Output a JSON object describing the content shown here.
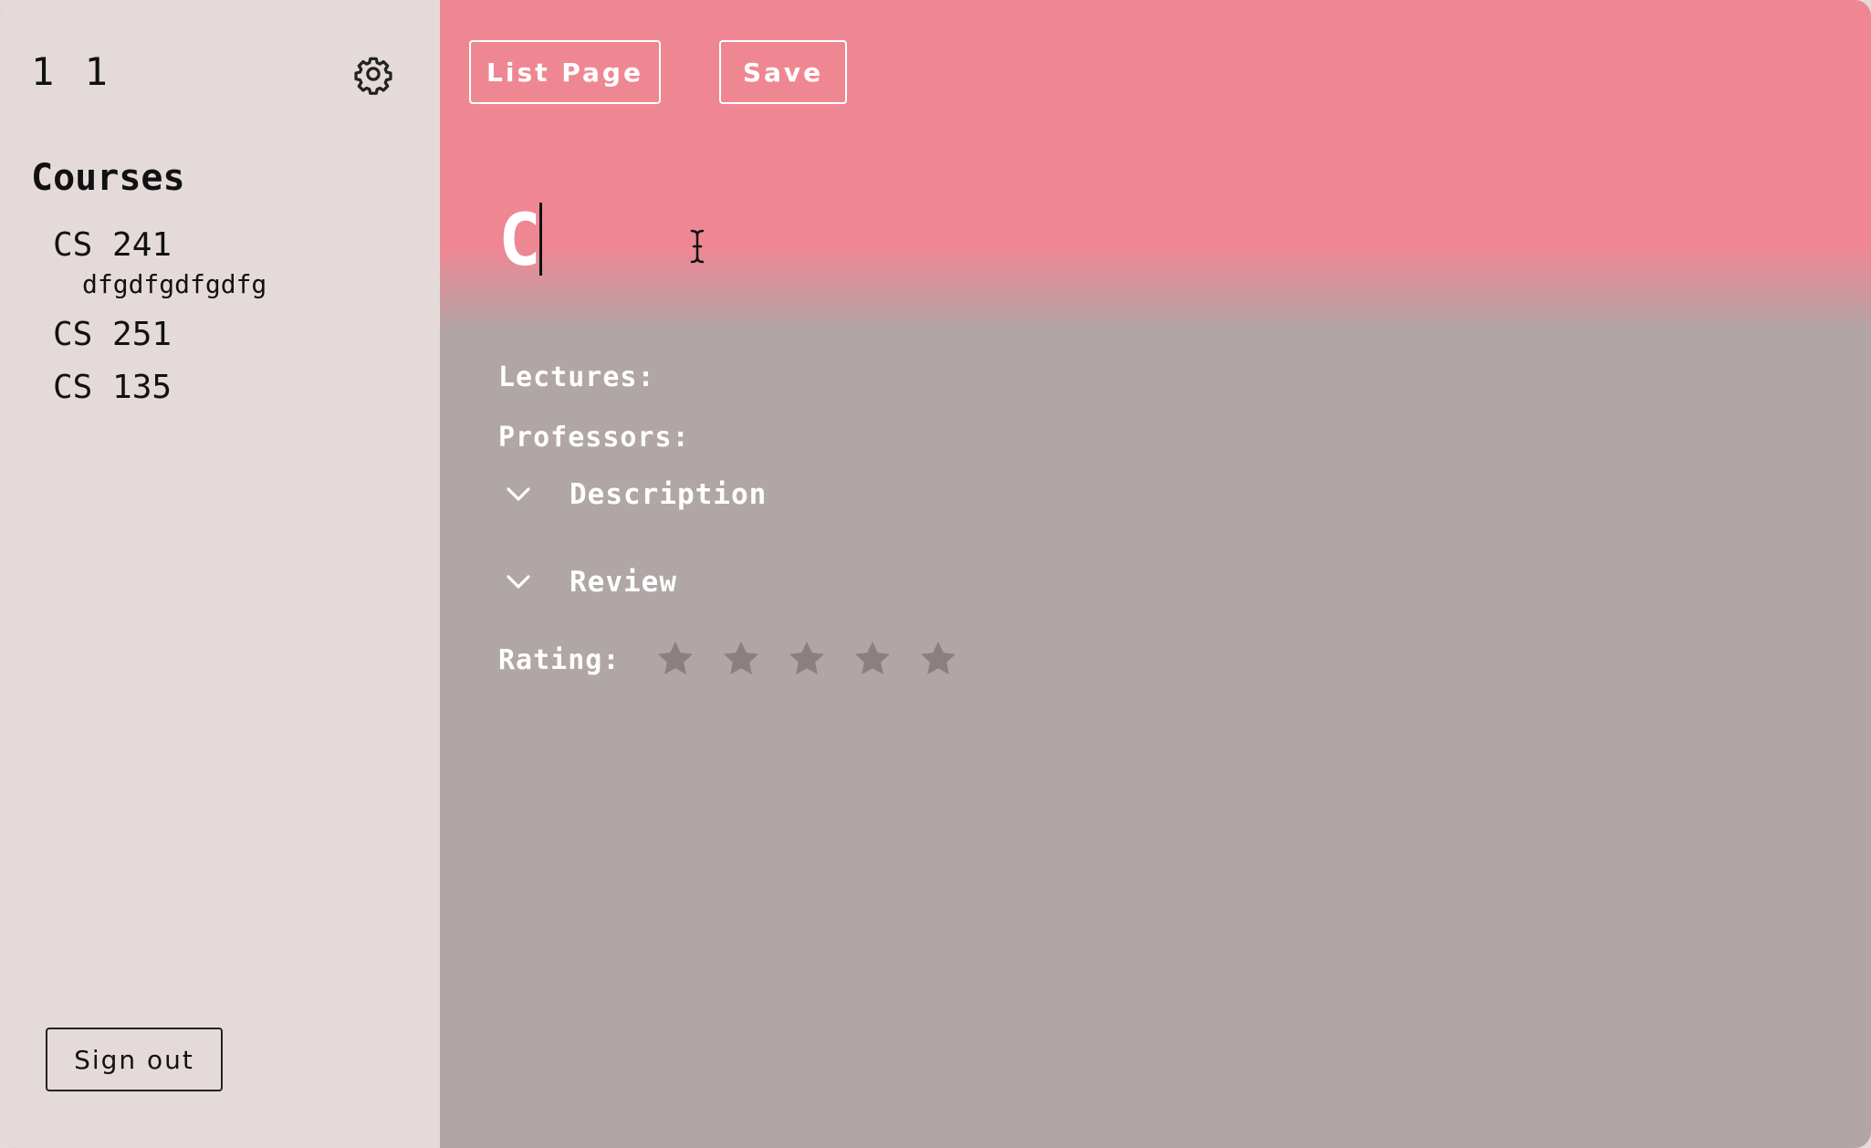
{
  "sidebar": {
    "user_name": "1 1",
    "settings_icon": "gear-icon",
    "courses_title": "Courses",
    "courses": [
      {
        "label": "CS 241",
        "sub": "dfgdfgdfgdfg"
      },
      {
        "label": "CS 251"
      },
      {
        "label": "CS 135"
      }
    ],
    "sign_out_label": "Sign out"
  },
  "toolbar": {
    "list_page_label": "List Page",
    "save_label": "Save"
  },
  "course": {
    "title_value": "C",
    "lectures_label": "Lectures:",
    "professors_label": "Professors:",
    "description_label": "Description",
    "review_label": "Review",
    "rating_label": "Rating:",
    "rating_value": 0,
    "rating_max": 5
  },
  "colors": {
    "header_accent": "#ef8793",
    "sidebar_bg": "#e5dada",
    "main_bg": "#b0a6a6",
    "star_empty": "#8a8080"
  }
}
